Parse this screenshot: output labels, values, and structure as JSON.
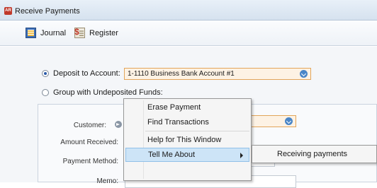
{
  "window": {
    "title": "Receive Payments",
    "app_icon_label": "AR"
  },
  "toolbar": {
    "journal_label": "Journal",
    "register_label": "Register"
  },
  "deposit": {
    "deposit_label": "Deposit to Account:",
    "account_value": "1-1110 Business Bank Account #1",
    "group_label": "Group with Undeposited Funds:"
  },
  "form": {
    "customer_label": "Customer:",
    "amount_label": "Amount Received:",
    "payment_method_label": "Payment Method:",
    "memo_label": "Memo:"
  },
  "context_menu": {
    "items": [
      {
        "label": "Erase Payment"
      },
      {
        "label": "Find Transactions"
      },
      {
        "label": "Help for This Window"
      },
      {
        "label": "Tell Me About"
      }
    ],
    "submenu": {
      "items": [
        {
          "label": "Receiving payments"
        }
      ]
    }
  }
}
